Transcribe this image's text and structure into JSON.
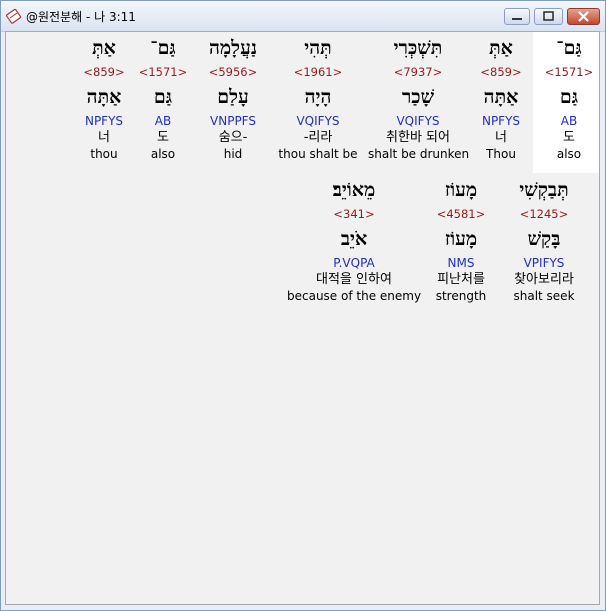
{
  "window": {
    "title": "@원전분해 - 나 3:11",
    "app_icon": "dictionary-app-icon",
    "controls": [
      "minimize-icon",
      "maximize-icon",
      "close-icon"
    ]
  },
  "rows": [
    {
      "words": [
        {
          "hebrew": "גַּם־",
          "strong": "<1571>",
          "lemma": "גַּם",
          "morph": "AB",
          "korean": "도",
          "english": "also",
          "highlighted": true
        },
        {
          "hebrew": "אַתְּ",
          "strong": "<859>",
          "lemma": "אַתָּה",
          "morph": "NPFYS",
          "korean": "너",
          "english": "Thou",
          "highlighted": false
        },
        {
          "hebrew": "תִּשְׁכְּרִי",
          "strong": "<7937>",
          "lemma": "שָׁכַר",
          "morph": "VQIFYS",
          "korean": "취한바 되어",
          "english": "shalt be drunken",
          "highlighted": false
        },
        {
          "hebrew": "תְּהִי",
          "strong": "<1961>",
          "lemma": "הָיָה",
          "morph": "VQIFYS",
          "korean": "-리라",
          "english": "thou shalt be",
          "highlighted": false
        },
        {
          "hebrew": "נַעֲלָמָה",
          "strong": "<5956>",
          "lemma": "עָלַם",
          "morph": "VNPPFS",
          "korean": "숨으-",
          "english": "hid",
          "highlighted": false
        },
        {
          "hebrew": "גַּם־",
          "strong": "<1571>",
          "lemma": "גַּם",
          "morph": "AB",
          "korean": "도",
          "english": "also",
          "highlighted": false
        },
        {
          "hebrew": "אַתְּ",
          "strong": "<859>",
          "lemma": "אַתָּה",
          "morph": "NPFYS",
          "korean": "너",
          "english": "thou",
          "highlighted": false
        }
      ]
    },
    {
      "words": [
        {
          "hebrew": "תְּבַקְשִׁי",
          "strong": "<1245>",
          "lemma": "בָּקַשׁ",
          "morph": "VPIFYS",
          "korean": "찾아보리라",
          "english": "shalt seek",
          "highlighted": false
        },
        {
          "hebrew": "מָעוֹז",
          "strong": "<4581>",
          "lemma": "מָעוֹז",
          "morph": "NMS",
          "korean": "피난처를",
          "english": "strength",
          "highlighted": false
        },
        {
          "hebrew": "מֵאוֹיֵב׃",
          "strong": "<341>",
          "lemma": "אֹיֵב",
          "morph": "P.VQPA",
          "korean": "대적을 인하여",
          "english": "because of the enemy",
          "highlighted": false
        }
      ]
    }
  ]
}
